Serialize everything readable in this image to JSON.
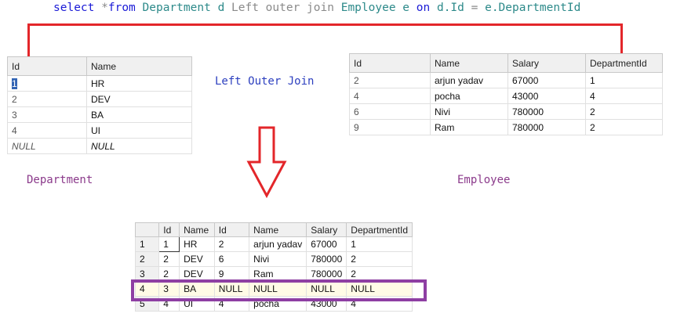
{
  "query": {
    "select": "select",
    "star_from": "*from",
    "table1": "Department",
    "alias1": "d",
    "join_words": "Left outer join",
    "table2": "Employee",
    "alias2": "e",
    "on": "on",
    "lhs": "d.Id",
    "eq": "=",
    "rhs": "e.DepartmentId"
  },
  "labels": {
    "join_type": "Left Outer Join",
    "department": "Department",
    "employee": "Employee"
  },
  "department_table": {
    "columns": [
      "Id",
      "Name"
    ],
    "rows": [
      [
        "1",
        "HR"
      ],
      [
        "2",
        "DEV"
      ],
      [
        "3",
        "BA"
      ],
      [
        "4",
        "UI"
      ],
      [
        "NULL",
        "NULL"
      ]
    ]
  },
  "employee_table": {
    "columns": [
      "Id",
      "Name",
      "Salary",
      "DepartmentId"
    ],
    "rows": [
      [
        "2",
        "arjun yadav",
        "67000",
        "1"
      ],
      [
        "4",
        "pocha",
        "43000",
        "4"
      ],
      [
        "6",
        "Nivi",
        "780000",
        "2"
      ],
      [
        "9",
        "Ram",
        "780000",
        "2"
      ]
    ]
  },
  "result_table": {
    "columns": [
      "Id",
      "Name",
      "Id",
      "Name",
      "Salary",
      "DepartmentId"
    ],
    "rows": [
      {
        "n": "1",
        "cells": [
          "1",
          "HR",
          "2",
          "arjun yadav",
          "67000",
          "1"
        ]
      },
      {
        "n": "2",
        "cells": [
          "2",
          "DEV",
          "6",
          "Nivi",
          "780000",
          "2"
        ]
      },
      {
        "n": "3",
        "cells": [
          "2",
          "DEV",
          "9",
          "Ram",
          "780000",
          "2"
        ]
      },
      {
        "n": "4",
        "cells": [
          "3",
          "BA",
          "NULL",
          "NULL",
          "NULL",
          "NULL"
        ]
      },
      {
        "n": "5",
        "cells": [
          "4",
          "UI",
          "4",
          "pocha",
          "43000",
          "4"
        ]
      }
    ],
    "highlighted_row": "4"
  },
  "colors": {
    "bracket": "#e3262a",
    "arrow": "#e3262a",
    "highlight_box": "#8e3fa3"
  }
}
